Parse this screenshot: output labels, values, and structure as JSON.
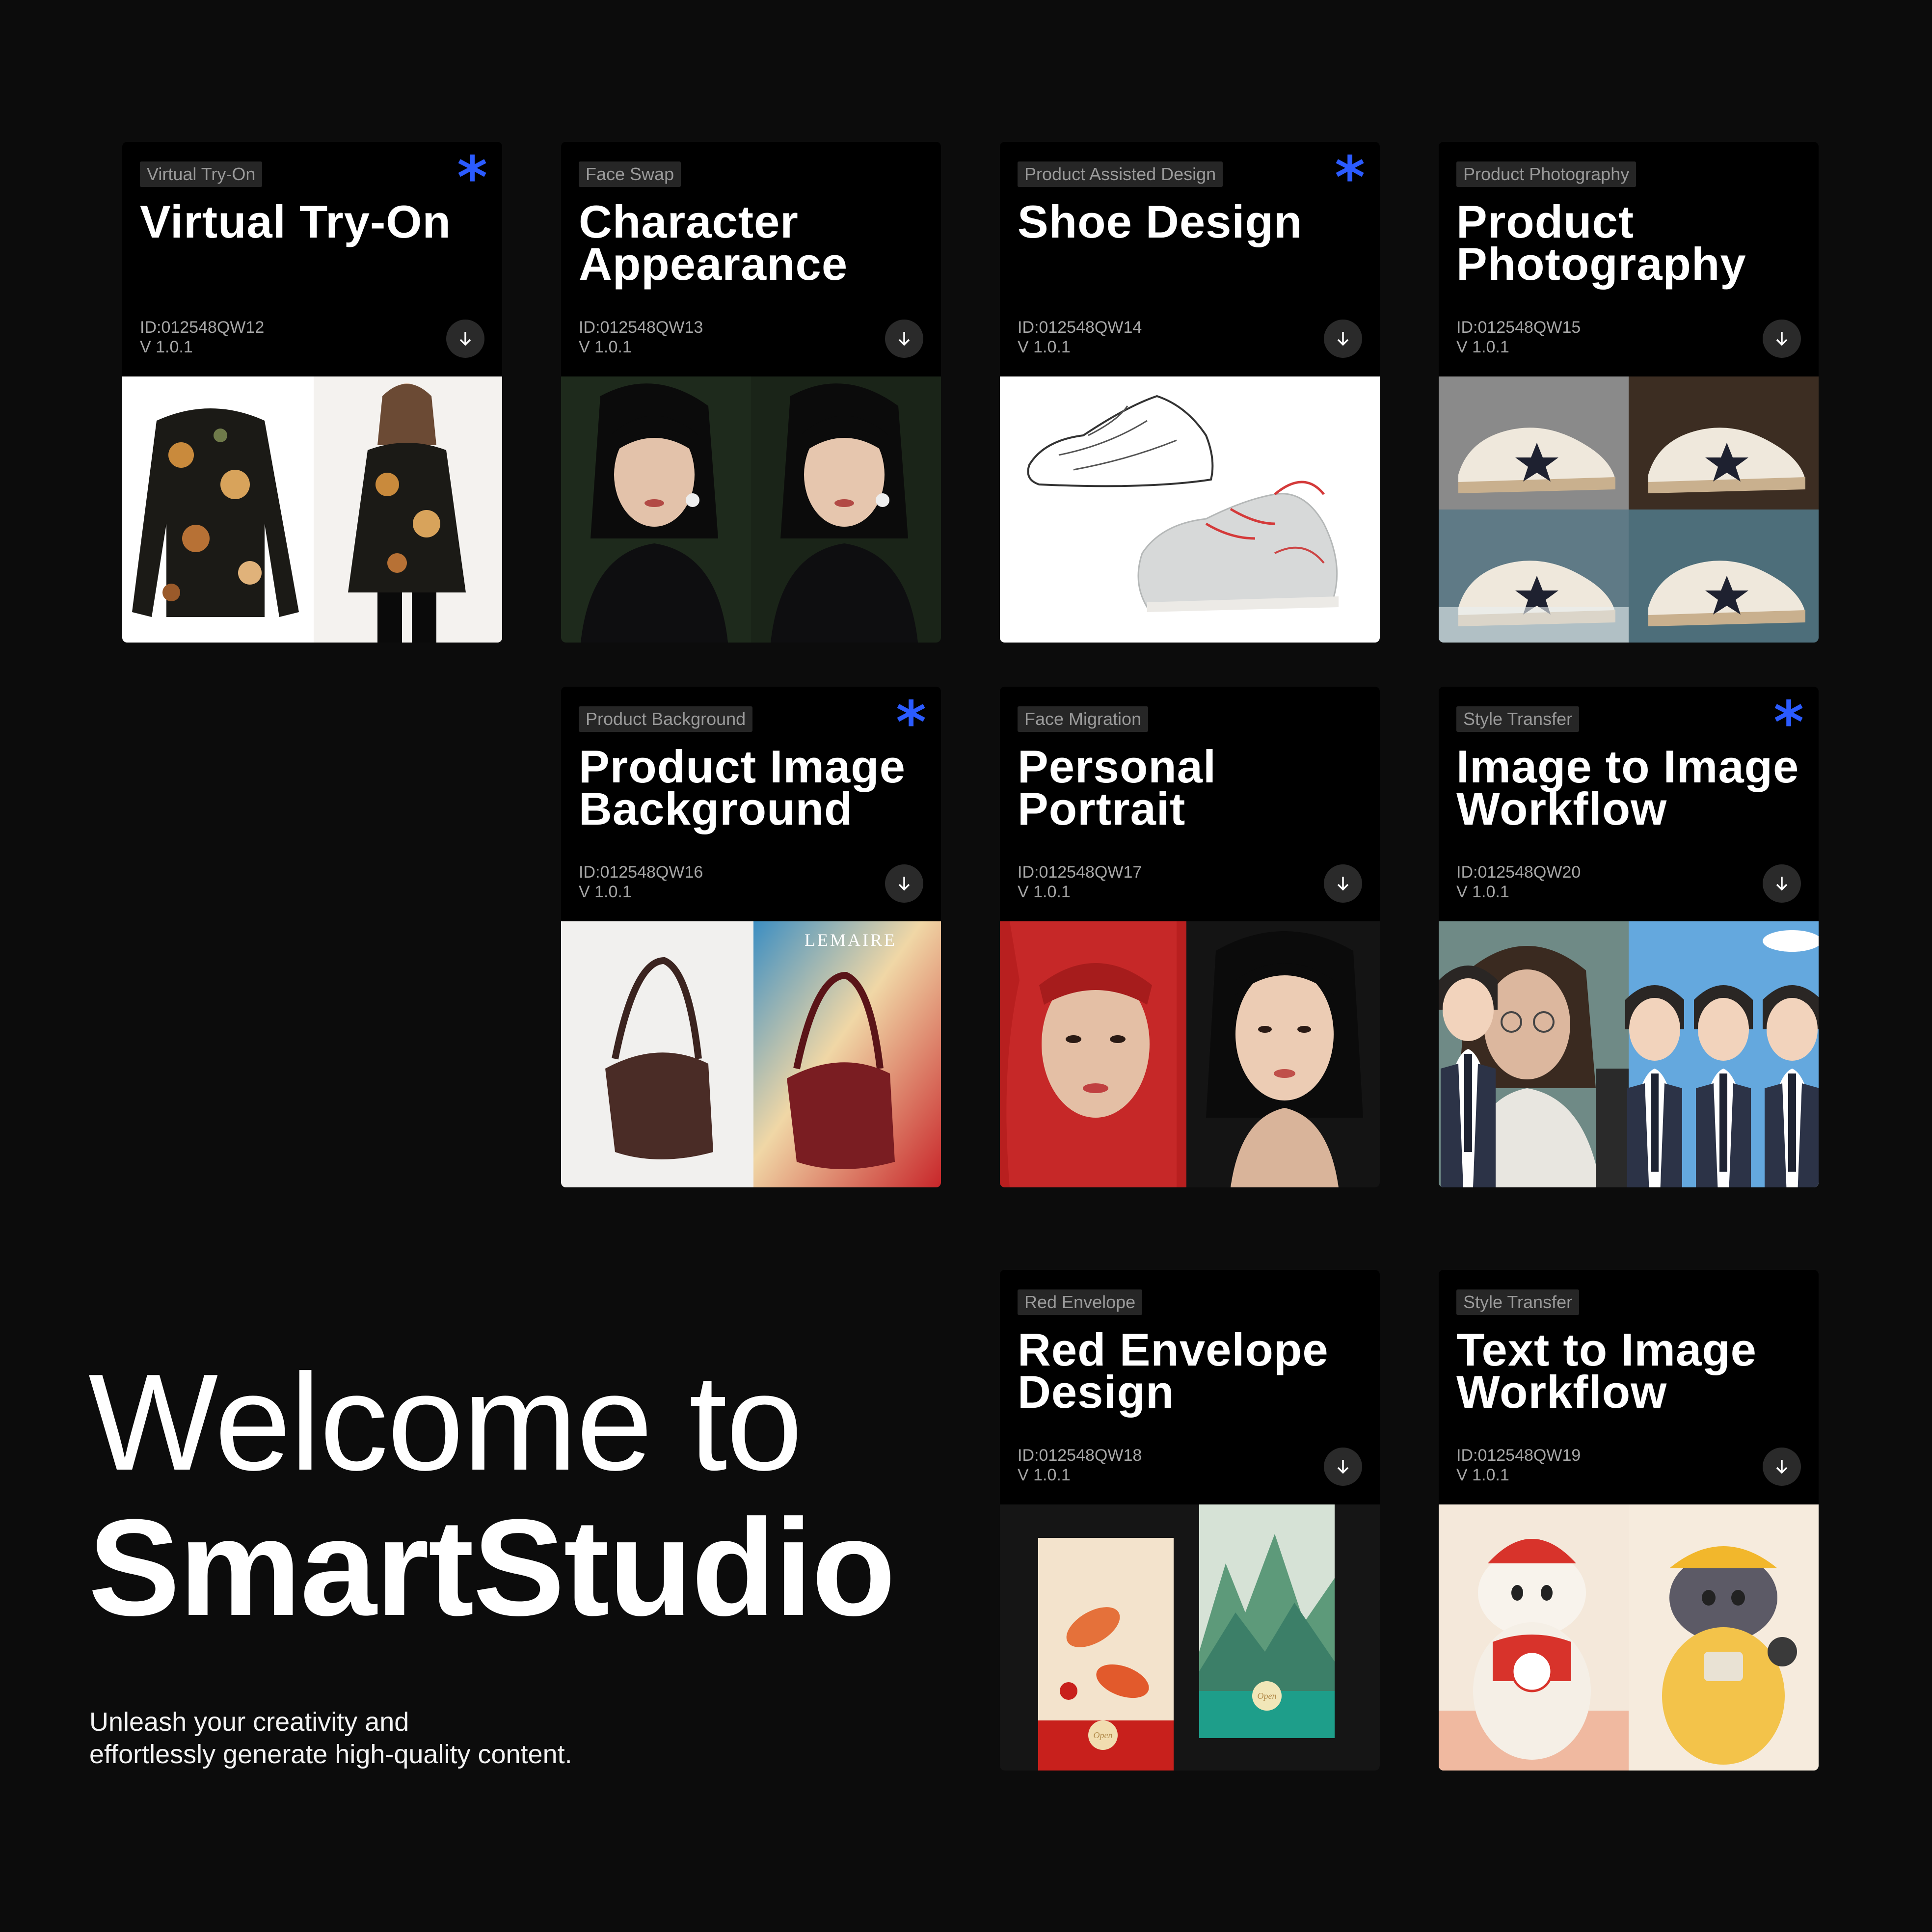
{
  "hero": {
    "line1": "Welcome to",
    "line2": "SmartStudio",
    "subtitle_line1": "Unleash your creativity and",
    "subtitle_line2": "effortlessly generate high-quality content."
  },
  "accent_color": "#2b5bff",
  "cards": [
    {
      "tag": "Virtual Try-On",
      "title_l1": "Virtual Try-On",
      "title_l2": "",
      "id": "ID:012548QW12",
      "version": "V 1.0.1",
      "featured": true,
      "image": "floral-blouse-on-model"
    },
    {
      "tag": "Face Swap",
      "title_l1": "Character",
      "title_l2": "Appearance",
      "id": "ID:012548QW13",
      "version": "V 1.0.1",
      "featured": false,
      "image": "portrait-pair"
    },
    {
      "tag": "Product Assisted Design",
      "title_l1": "Shoe Design",
      "title_l2": "",
      "id": "ID:012548QW14",
      "version": "V 1.0.1",
      "featured": true,
      "image": "shoe-sketch-and-render"
    },
    {
      "tag": "Product Photography",
      "title_l1": "Product",
      "title_l2": "Photography",
      "id": "ID:012548QW15",
      "version": "V 1.0.1",
      "featured": false,
      "image": "sneaker-grid"
    },
    {
      "tag": "Product Background",
      "title_l1": "Product Image",
      "title_l2": "Background",
      "id": "ID:012548QW16",
      "version": "V 1.0.1",
      "featured": true,
      "image": "handbag-backgrounds",
      "brand_text": "LEMAIRE"
    },
    {
      "tag": "Face Migration",
      "title_l1": "Personal",
      "title_l2": "Portrait",
      "id": "ID:012548QW17",
      "version": "V 1.0.1",
      "featured": false,
      "image": "portrait-pair-red-hood"
    },
    {
      "tag": "Style Transfer",
      "title_l1": "Image to Image",
      "title_l2": "Workflow",
      "id": "ID:012548QW20",
      "version": "V 1.0.1",
      "featured": true,
      "image": "photo-to-anime"
    },
    {
      "tag": "Red Envelope",
      "title_l1": "Red Envelope",
      "title_l2": "Design",
      "id": "ID:012548QW18",
      "version": "V 1.0.1",
      "featured": false,
      "image": "red-envelopes",
      "envelope_text": "Open"
    },
    {
      "tag": "Style Transfer",
      "title_l1": "Text to Image",
      "title_l2": "Workflow",
      "id": "ID:012548QW19",
      "version": "V 1.0.1",
      "featured": false,
      "image": "lucky-cats"
    }
  ]
}
